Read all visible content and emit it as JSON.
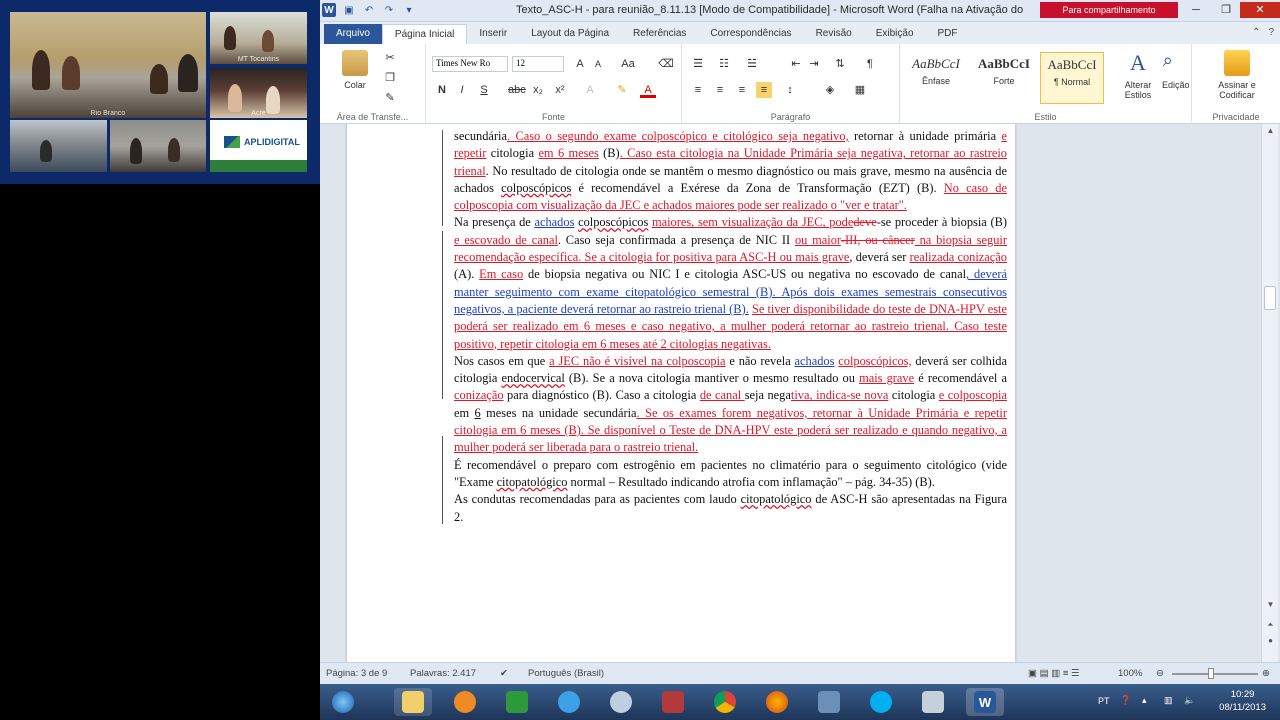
{
  "video": {
    "tiles": [
      {
        "caption": "Rio Branco"
      },
      {
        "caption": "MT Tocantins"
      },
      {
        "caption": "Acre"
      },
      {
        "caption": ""
      },
      {
        "caption": ""
      },
      {
        "caption": ""
      }
    ],
    "logo_text": "APLIDIGITAL"
  },
  "word": {
    "title": "Texto_ASC-H - para reunião_8.11.13 [Modo de Compatibilidade] - Microsoft Word (Falha na Ativação do",
    "share_label": "Para compartilhamento",
    "tabs": [
      "Arquivo",
      "Página Inicial",
      "Inserir",
      "Layout da Página",
      "Referências",
      "Correspondências",
      "Revisão",
      "Exibição",
      "PDF"
    ],
    "active_tab": "Página Inicial",
    "ribbon": {
      "clipboard": {
        "paste_label": "Colar",
        "group_label": "Área de Transfe..."
      },
      "font": {
        "name": "Times New Ro",
        "size": "12",
        "group_label": "Fonte"
      },
      "paragraph": {
        "group_label": "Parágrafo"
      },
      "styles": {
        "items": [
          {
            "preview": "AaBbCcI",
            "name": "Ênfase"
          },
          {
            "preview": "AaBbCcI",
            "name": "Forte"
          },
          {
            "preview": "AaBbCcI",
            "name": "¶ Normal"
          }
        ],
        "change_styles": "Alterar Estilos",
        "group_label": "Estilo"
      },
      "editing": {
        "label": "Edição"
      },
      "privacy": {
        "label": "Assinar e Codificar",
        "group_label": "Privacidade"
      }
    },
    "status": {
      "page": "Página: 3 de 9",
      "words": "Palavras: 2.417",
      "language": "Português (Brasil)",
      "zoom": "100%"
    }
  },
  "taskbar": {
    "time": "10:29",
    "date": "08/11/2013",
    "lang": "PT"
  }
}
